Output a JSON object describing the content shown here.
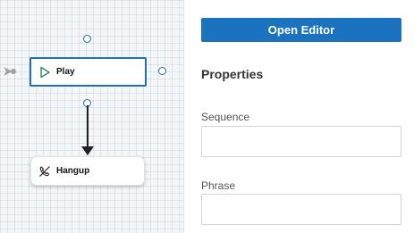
{
  "canvas": {
    "nodes": [
      {
        "label": "Play",
        "icon": "play-icon"
      },
      {
        "label": "Hangup",
        "icon": "hangup-icon"
      }
    ]
  },
  "panel": {
    "open_editor_label": "Open Editor",
    "title": "Properties",
    "fields": [
      {
        "label": "Sequence",
        "value": ""
      },
      {
        "label": "Phrase",
        "value": ""
      }
    ]
  },
  "colors": {
    "accent": "#1b73c0",
    "node_border": "#1f6fb3",
    "canvas_bg": "#f4f6f8"
  }
}
